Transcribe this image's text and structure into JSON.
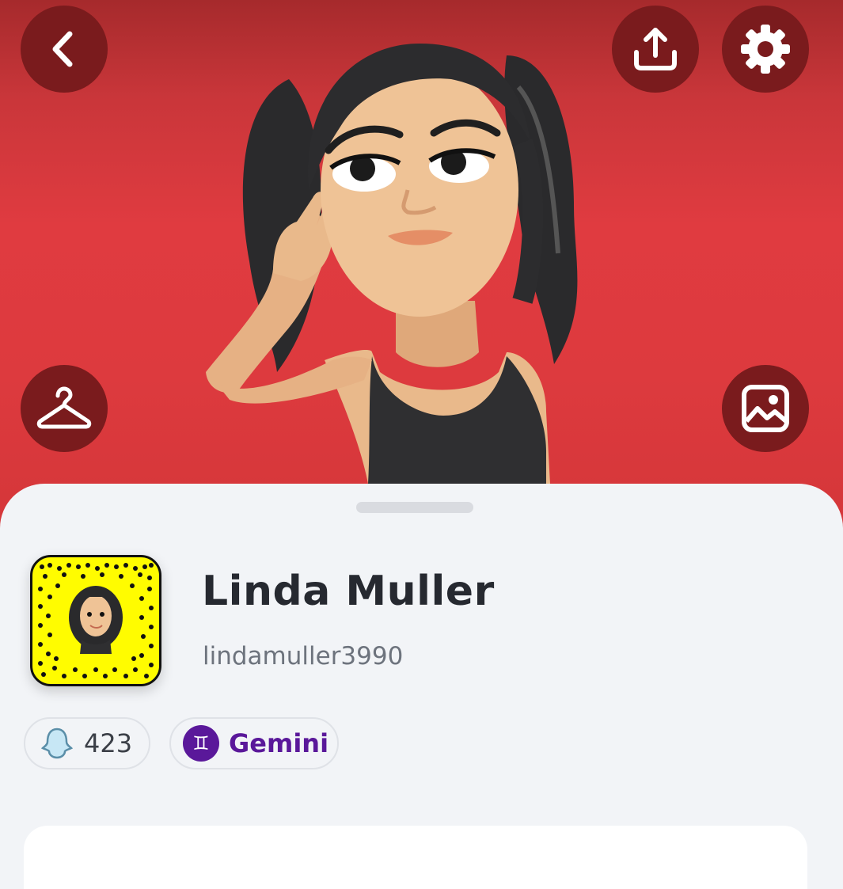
{
  "colors": {
    "hero_background": "#e03b40",
    "button_background": "#7a1b1d",
    "snapcode_yellow": "#fffc00",
    "zodiac_purple": "#5a189a",
    "sheet_background": "#f2f4f7"
  },
  "header": {
    "back_icon": "chevron-left-icon",
    "share_icon": "upload-icon",
    "settings_icon": "gear-icon"
  },
  "hero": {
    "outfit_icon": "hanger-icon",
    "photo_icon": "image-icon"
  },
  "profile": {
    "display_name": "Linda Muller",
    "username": "lindamuller3990",
    "snap_score": "423",
    "zodiac_sign": "Gemini",
    "zodiac_symbol": "♊"
  }
}
